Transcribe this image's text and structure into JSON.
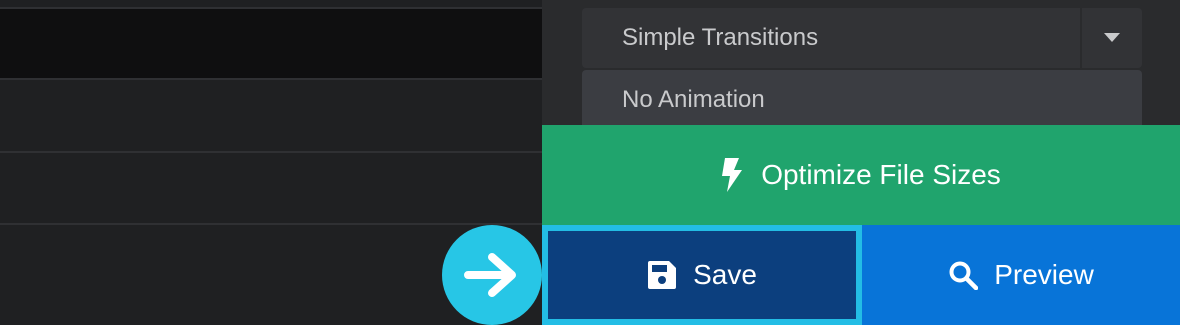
{
  "animation_select": {
    "selected": "Simple Transitions",
    "caret_icon": "caret-down-icon"
  },
  "animation_options": {
    "items": [
      {
        "label": "No Animation"
      }
    ]
  },
  "actions": {
    "optimize_label": "Optimize File Sizes",
    "optimize_icon": "lightning-bolt-icon",
    "save_label": "Save",
    "save_icon": "floppy-disk-icon",
    "preview_label": "Preview",
    "preview_icon": "magnifier-icon"
  },
  "pointer": {
    "icon": "arrow-right-icon"
  },
  "colors": {
    "optimize_bg": "#20a46d",
    "save_bg": "#0c3f7e",
    "save_highlight": "#23bde5",
    "preview_bg": "#0874d8",
    "pointer_bg": "#27c6e6"
  }
}
